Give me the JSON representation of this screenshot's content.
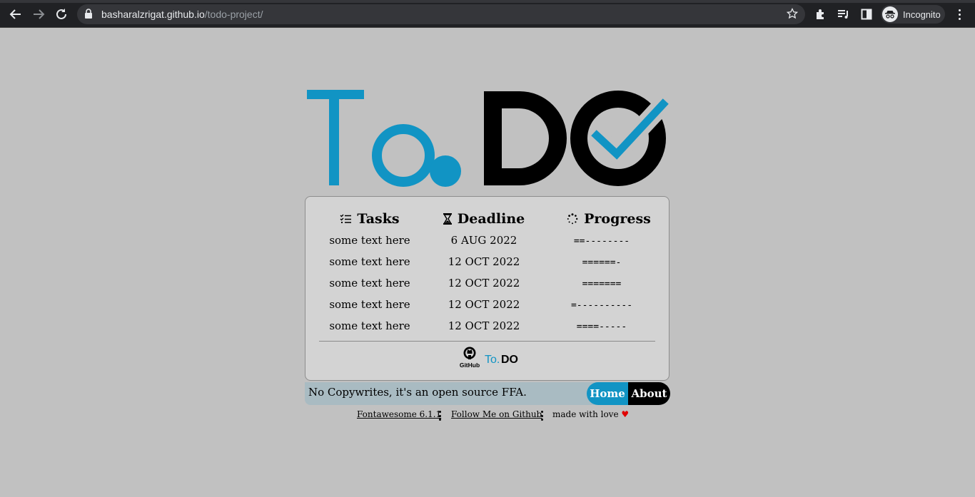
{
  "browser": {
    "url_host": "basharalzrigat.github.io",
    "url_path": "/todo-project/",
    "profile_label": "Incognito"
  },
  "logo": {
    "left_text": "To.",
    "right_text": "DO",
    "colors": {
      "blue": "#1194c4",
      "black": "#000000"
    }
  },
  "table": {
    "headers": {
      "tasks": "Tasks",
      "deadline": "Deadline",
      "progress": "Progress"
    },
    "rows": [
      {
        "task": "some text here",
        "deadline": "6 AUG 2022",
        "progress": "==--------"
      },
      {
        "task": "some text here",
        "deadline": "12 OCT 2022",
        "progress": "======-"
      },
      {
        "task": "some text here",
        "deadline": "12 OCT 2022",
        "progress": "======="
      },
      {
        "task": "some text here",
        "deadline": "12 OCT 2022",
        "progress": "=----------"
      },
      {
        "task": "some text here",
        "deadline": "12 OCT 2022",
        "progress": "====-----"
      }
    ]
  },
  "card_footer": {
    "github_label": "GitHub",
    "mini_logo_left": "To.",
    "mini_logo_right": "DO"
  },
  "footer": {
    "copy_text": "No Copywrites, it's an open source FFA.",
    "home_label": "Home",
    "about_label": "About"
  },
  "links": {
    "fontawesome": "Fontawesome 6.1.1",
    "github": "Follow Me on Github",
    "love_text": "made with love",
    "heart": "♥"
  }
}
